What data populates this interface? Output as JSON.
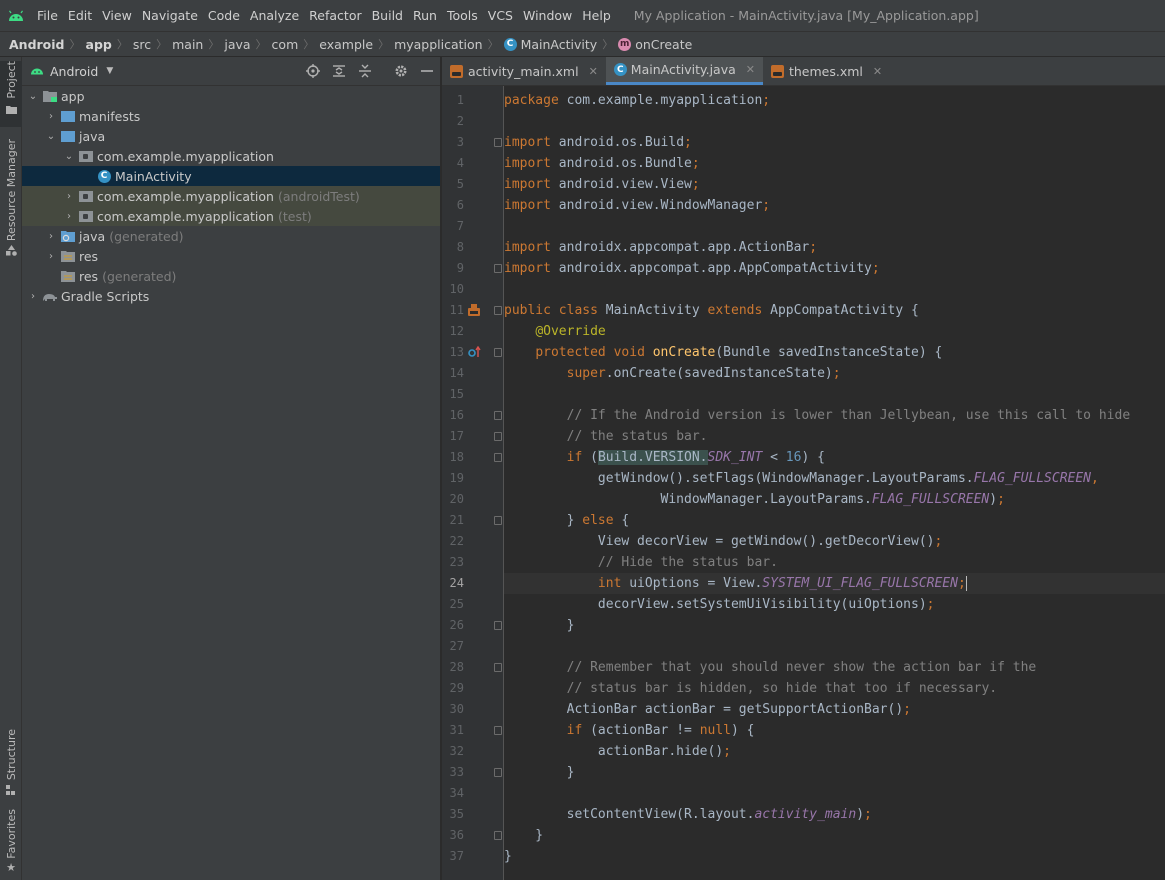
{
  "menu": {
    "items": [
      "File",
      "Edit",
      "View",
      "Navigate",
      "Code",
      "Analyze",
      "Refactor",
      "Build",
      "Run",
      "Tools",
      "VCS",
      "Window",
      "Help"
    ],
    "window_title": "My Application - MainActivity.java [My_Application.app]"
  },
  "breadcrumb": [
    "Android",
    "app",
    "src",
    "main",
    "java",
    "com",
    "example",
    "myapplication",
    "MainActivity",
    "onCreate"
  ],
  "tool_strip": {
    "project": "Project",
    "resource_manager": "Resource Manager",
    "structure": "Structure",
    "favorites": "Favorites"
  },
  "project_panel": {
    "view_selector": "Android",
    "tree": [
      {
        "label": "app",
        "suffix": ""
      },
      {
        "label": "manifests",
        "suffix": ""
      },
      {
        "label": "java",
        "suffix": ""
      },
      {
        "label": "com.example.myapplication",
        "suffix": ""
      },
      {
        "label": "MainActivity",
        "suffix": ""
      },
      {
        "label": "com.example.myapplication",
        "suffix": "(androidTest)"
      },
      {
        "label": "com.example.myapplication",
        "suffix": "(test)"
      },
      {
        "label": "java",
        "suffix": "(generated)"
      },
      {
        "label": "res",
        "suffix": ""
      },
      {
        "label": "res",
        "suffix": "(generated)"
      },
      {
        "label": "Gradle Scripts",
        "suffix": ""
      }
    ]
  },
  "editor": {
    "tabs": [
      {
        "label": "activity_main.xml",
        "active": false
      },
      {
        "label": "MainActivity.java",
        "active": true
      },
      {
        "label": "themes.xml",
        "active": false
      }
    ],
    "current_line": 24,
    "lines": [
      "package com.example.myapplication;",
      "",
      "import android.os.Build;",
      "import android.os.Bundle;",
      "import android.view.View;",
      "import android.view.WindowManager;",
      "",
      "import androidx.appcompat.app.ActionBar;",
      "import androidx.appcompat.app.AppCompatActivity;",
      "",
      "public class MainActivity extends AppCompatActivity {",
      "    @Override",
      "    protected void onCreate(Bundle savedInstanceState) {",
      "        super.onCreate(savedInstanceState);",
      "",
      "        // If the Android version is lower than Jellybean, use this call to hide",
      "        // the status bar.",
      "        if (Build.VERSION.SDK_INT < 16) {",
      "            getWindow().setFlags(WindowManager.LayoutParams.FLAG_FULLSCREEN,",
      "                    WindowManager.LayoutParams.FLAG_FULLSCREEN);",
      "        } else {",
      "            View decorView = getWindow().getDecorView();",
      "            // Hide the status bar.",
      "            int uiOptions = View.SYSTEM_UI_FLAG_FULLSCREEN;",
      "            decorView.setSystemUiVisibility(uiOptions);",
      "        }",
      "",
      "        // Remember that you should never show the action bar if the",
      "        // status bar is hidden, so hide that too if necessary.",
      "        ActionBar actionBar = getSupportActionBar();",
      "        if (actionBar != null) {",
      "            actionBar.hide();",
      "        }",
      "",
      "        setContentView(R.layout.activity_main);",
      "    }",
      "}"
    ]
  },
  "colors": {
    "keyword": "#cc7832",
    "annotation": "#bbb529",
    "method": "#ffc66d",
    "comment": "#808080",
    "number": "#6897bb",
    "static_field": "#9876aa",
    "default_text": "#a9b7c6",
    "selection": "#0d293e",
    "accent": "#4a88c7"
  }
}
